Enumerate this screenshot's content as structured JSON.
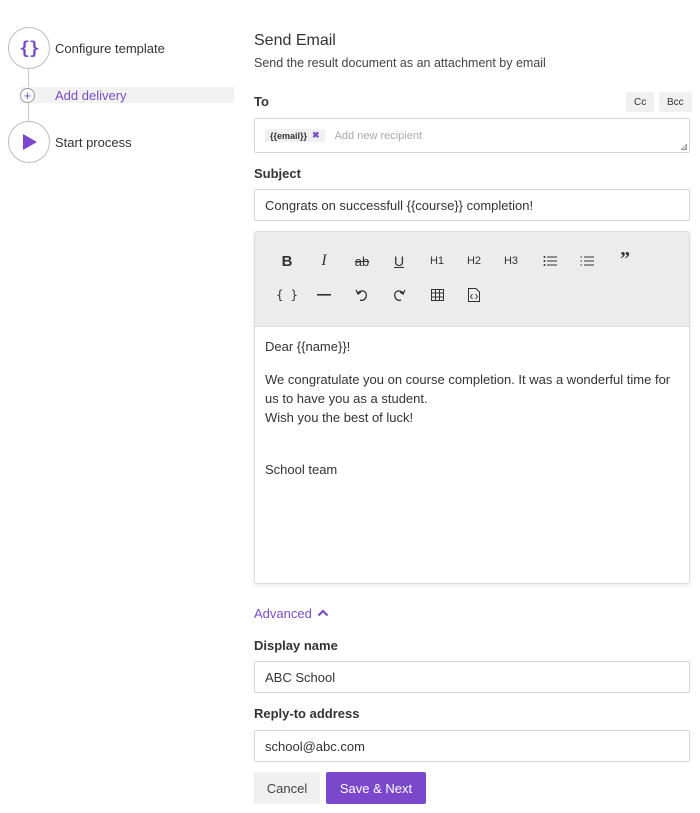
{
  "stepper": {
    "steps": [
      {
        "label": "Configure template",
        "icon": "braces-icon"
      },
      {
        "label": "Add delivery",
        "icon": "plus-icon"
      },
      {
        "label": "Start process",
        "icon": "play-icon"
      }
    ],
    "braces_glyph": "{}",
    "plus_glyph": "+"
  },
  "header": {
    "title": "Send Email",
    "subtitle": "Send the result document as an attachment by email"
  },
  "to": {
    "label": "To",
    "cc_label": "Cc",
    "bcc_label": "Bcc",
    "chip": "{{email}}",
    "chip_remove": "✖",
    "placeholder": "Add new recipient"
  },
  "subject": {
    "label": "Subject",
    "value": "Congrats on successfull {{course}} completion!"
  },
  "editor": {
    "toolbar": {
      "bold": "B",
      "italic": "I",
      "strike": "ab",
      "underline": "U",
      "h1": "H1",
      "h2": "H2",
      "h3": "H3",
      "quote": "”",
      "variable": "{ }"
    },
    "body": {
      "greeting": "Dear {{name}}!",
      "line1": "We congratulate you on course completion. It was a wonderful time for us to have you as a student.",
      "line2": "Wish you the best of luck!",
      "signature": "School team"
    }
  },
  "advanced": {
    "label": "Advanced"
  },
  "display_name": {
    "label": "Display name",
    "value": "ABC School"
  },
  "reply_to": {
    "label": "Reply-to address",
    "value": "school@abc.com"
  },
  "actions": {
    "cancel": "Cancel",
    "save": "Save & Next"
  },
  "colors": {
    "accent": "#7b48cc",
    "toolbar_bg": "#ececec",
    "chip_bg": "#f0f0f0"
  }
}
